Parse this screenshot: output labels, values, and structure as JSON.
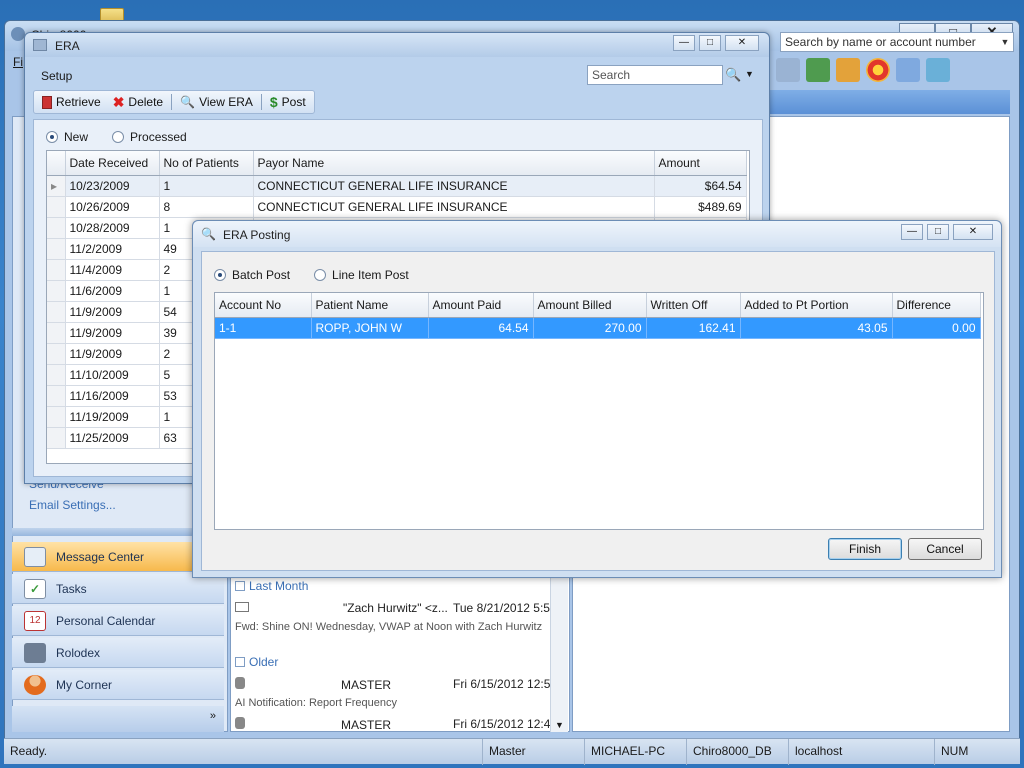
{
  "main": {
    "title": "Chiro8000",
    "menu_first": "Fi",
    "search_placeholder": "Search by name or account number",
    "left_links": {
      "send_receive": "Send/Receive",
      "email_settings": "Email Settings..."
    },
    "nav": [
      {
        "label": "Message Center",
        "icon": "mail-icon"
      },
      {
        "label": "Tasks",
        "icon": "checkmark-icon"
      },
      {
        "label": "Personal Calendar",
        "icon": "calendar-icon"
      },
      {
        "label": "Rolodex",
        "icon": "rolodex-icon"
      },
      {
        "label": "My Corner",
        "icon": "person-icon"
      }
    ],
    "messages": {
      "group_last_month": "Last Month",
      "group_older": "Older",
      "items": [
        {
          "from": "\"Zach Hurwitz\" <z...",
          "date": "Tue 8/21/2012 5:5...",
          "subject": "Fwd: Shine ON! Wednesday, VWAP at Noon with Zach Hurwitz"
        },
        {
          "from": "MASTER",
          "date": "Fri 6/15/2012 12:5...",
          "subject": "AI Notification: Report Frequency"
        },
        {
          "from": "MASTER",
          "date": "Fri 6/15/2012 12:4...",
          "subject": ""
        }
      ]
    },
    "status": {
      "ready": "Ready.",
      "user": "Master",
      "machine": "MICHAEL-PC",
      "db": "Chiro8000_DB",
      "server": "localhost",
      "num": "NUM"
    }
  },
  "era": {
    "title": "ERA",
    "menu_setup": "Setup",
    "search_placeholder": "Search",
    "toolbar": {
      "retrieve": "Retrieve",
      "delete": "Delete",
      "view_era": "View ERA",
      "post": "Post"
    },
    "filter": {
      "new": "New",
      "processed": "Processed"
    },
    "columns": {
      "date": "Date Received",
      "patients": "No of Patients",
      "payor": "Payor Name",
      "amount": "Amount"
    },
    "rows": [
      {
        "date": "10/23/2009",
        "patients": "1",
        "payor": "CONNECTICUT GENERAL LIFE INSURANCE",
        "amount": "$64.54"
      },
      {
        "date": "10/26/2009",
        "patients": "8",
        "payor": "CONNECTICUT GENERAL LIFE INSURANCE",
        "amount": "$489.69"
      },
      {
        "date": "10/28/2009",
        "patients": "1",
        "payor": "",
        "amount": ""
      },
      {
        "date": "11/2/2009",
        "patients": "49",
        "payor": "",
        "amount": ""
      },
      {
        "date": "11/4/2009",
        "patients": "2",
        "payor": "",
        "amount": ""
      },
      {
        "date": "11/6/2009",
        "patients": "1",
        "payor": "",
        "amount": ""
      },
      {
        "date": "11/9/2009",
        "patients": "54",
        "payor": "",
        "amount": ""
      },
      {
        "date": "11/9/2009",
        "patients": "39",
        "payor": "",
        "amount": ""
      },
      {
        "date": "11/9/2009",
        "patients": "2",
        "payor": "",
        "amount": ""
      },
      {
        "date": "11/10/2009",
        "patients": "5",
        "payor": "",
        "amount": ""
      },
      {
        "date": "11/16/2009",
        "patients": "53",
        "payor": "",
        "amount": ""
      },
      {
        "date": "11/19/2009",
        "patients": "1",
        "payor": "",
        "amount": ""
      },
      {
        "date": "11/25/2009",
        "patients": "63",
        "payor": "",
        "amount": ""
      }
    ]
  },
  "posting": {
    "title": "ERA Posting",
    "mode": {
      "batch": "Batch Post",
      "line_item": "Line Item Post"
    },
    "columns": {
      "account": "Account No",
      "patient": "Patient Name",
      "paid": "Amount Paid",
      "billed": "Amount Billed",
      "written_off": "Written Off",
      "pt_portion": "Added to Pt Portion",
      "difference": "Difference"
    },
    "rows": [
      {
        "account": "1-1",
        "patient": "ROPP, JOHN W",
        "paid": "64.54",
        "billed": "270.00",
        "written_off": "162.41",
        "pt_portion": "43.05",
        "difference": "0.00"
      }
    ],
    "buttons": {
      "finish": "Finish",
      "cancel": "Cancel"
    }
  },
  "colors": {
    "selection": "#3399ff",
    "nav_active": "#f7b94c",
    "desktop": "#2f74bd"
  }
}
